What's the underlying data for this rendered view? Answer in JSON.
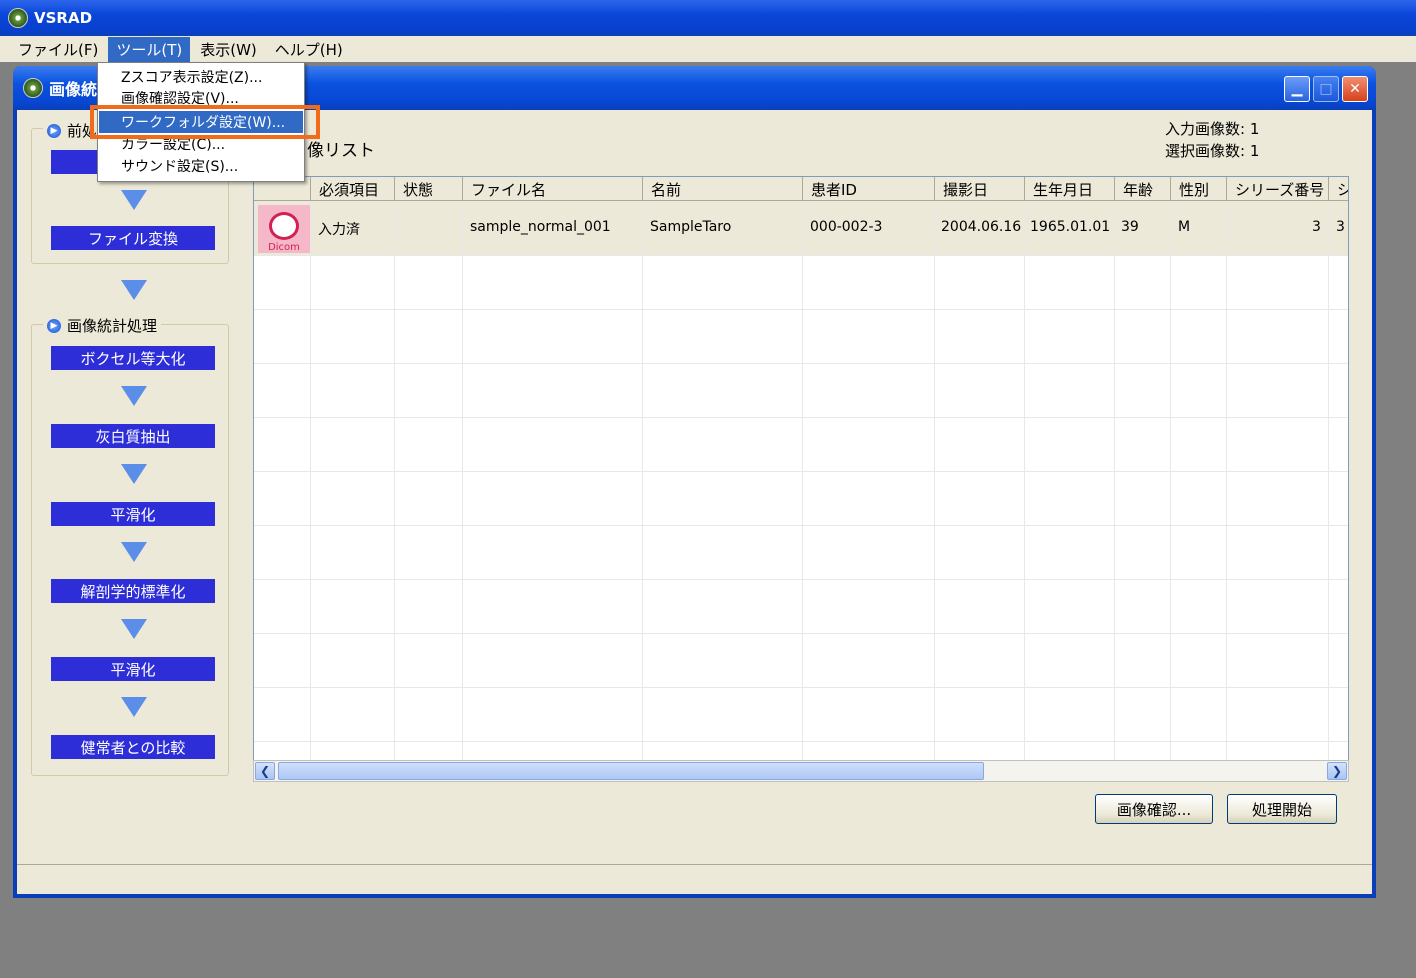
{
  "app": {
    "title": "VSRAD"
  },
  "menubar": [
    {
      "label": "ファイル(F)"
    },
    {
      "label": "ツール(T)"
    },
    {
      "label": "表示(W)"
    },
    {
      "label": "ヘルプ(H)"
    }
  ],
  "inner_window": {
    "title": "画像統"
  },
  "dropdown": {
    "items": [
      {
        "label": "Zスコア表示設定(Z)..."
      },
      {
        "label": "画像確認設定(V)..."
      },
      {
        "label": "ワークフォルダ設定(W)..."
      },
      {
        "label": "カラー設定(C)..."
      },
      {
        "label": "サウンド設定(S)..."
      }
    ]
  },
  "workflow": {
    "group1": {
      "label": "前処理",
      "steps": [
        "ファイル変換"
      ]
    },
    "group2": {
      "label": "画像統計処理",
      "steps": [
        "ボクセル等大化",
        "灰白質抽出",
        "平滑化",
        "解剖学的標準化",
        "平滑化",
        "健常者との比較"
      ]
    }
  },
  "list": {
    "title": "像リスト",
    "input_count_label": "入力画像数: 1",
    "selected_count_label": "選択画像数: 1"
  },
  "table": {
    "headers": [
      "必須項目",
      "状態",
      "ファイル名",
      "名前",
      "患者ID",
      "撮影日",
      "生年月日",
      "年齢",
      "性別",
      "シリーズ番号",
      "シ"
    ],
    "rows": [
      {
        "icon_text": "Dicom",
        "required": "入力済",
        "state": "",
        "filename": "sample_normal_001",
        "name": "SampleTaro",
        "patient_id": "000-002-3",
        "shot_date": "2004.06.16",
        "birth": "1965.01.01",
        "age": "39",
        "sex": "M",
        "series": "3",
        "extra": "3"
      }
    ]
  },
  "buttons": {
    "confirm": "画像確認...",
    "start": "処理開始"
  }
}
